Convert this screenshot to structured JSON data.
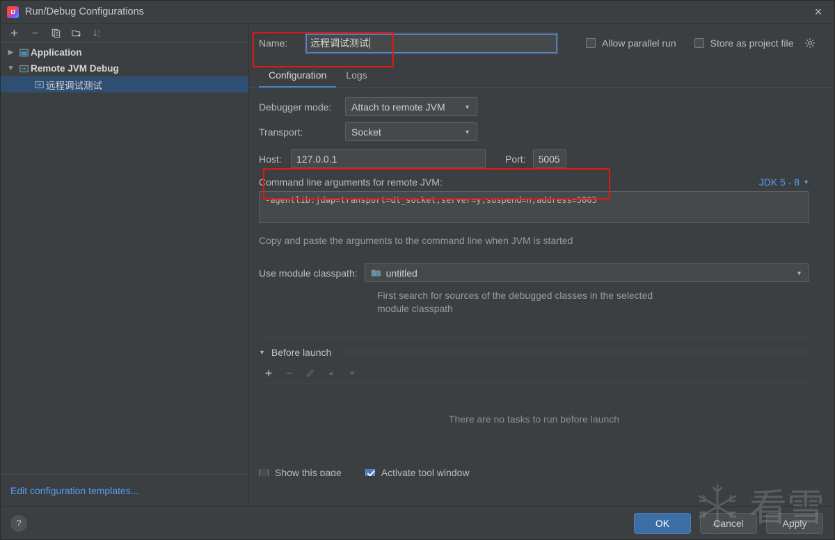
{
  "window": {
    "title": "Run/Debug Configurations",
    "app_icon": "intellij-idea-icon",
    "close_label": "×"
  },
  "sidebar": {
    "toolbar": [
      {
        "name": "add-configuration-button",
        "glyph": "+",
        "enabled": true
      },
      {
        "name": "remove-configuration-button",
        "glyph": "−",
        "enabled": false
      },
      {
        "name": "copy-configuration-button",
        "glyph": "copy-icon",
        "enabled": true
      },
      {
        "name": "new-folder-button",
        "glyph": "folder-add-icon",
        "enabled": true
      },
      {
        "name": "sort-configurations-button",
        "glyph": "sort-az-icon",
        "enabled": false
      }
    ],
    "tree": [
      {
        "label": "Application",
        "expanded": false,
        "selected": false,
        "icon": "application-icon",
        "level": 0
      },
      {
        "label": "Remote JVM Debug",
        "expanded": true,
        "selected": false,
        "icon": "remote-debug-icon",
        "level": 0
      },
      {
        "label": "远程调试测试",
        "expanded": null,
        "selected": true,
        "icon": "remote-debug-icon",
        "level": 1
      }
    ],
    "edit_templates_link": "Edit configuration templates..."
  },
  "header": {
    "name_label": "Name:",
    "name_value": "远程调试测试",
    "allow_parallel_run": {
      "label": "Allow parallel run",
      "checked": false
    },
    "store_as_project_file": {
      "label": "Store as project file",
      "checked": false
    },
    "gear_icon": "gear-icon"
  },
  "tabs": [
    {
      "label": "Configuration",
      "active": true
    },
    {
      "label": "Logs",
      "active": false
    }
  ],
  "configuration": {
    "debugger_mode": {
      "label": "Debugger mode:",
      "value": "Attach to remote JVM"
    },
    "transport": {
      "label": "Transport:",
      "value": "Socket"
    },
    "host": {
      "label": "Host:",
      "value": "127.0.0.1"
    },
    "port": {
      "label": "Port:",
      "value": "5005"
    },
    "args_title": "Command line arguments for remote JVM:",
    "jdk_select": "JDK 5 - 8",
    "args_value": "-agentlib:jdwp=transport=dt_socket,server=y,suspend=n,address=5005",
    "args_hint": "Copy and paste the arguments to the command line when JVM is started",
    "classpath": {
      "label": "Use module classpath:",
      "value": "untitled",
      "hint": "First search for sources of the debugged classes in the selected module classpath"
    }
  },
  "before_launch": {
    "title": "Before launch",
    "expanded": true,
    "toolbar": [
      {
        "name": "add-task-button",
        "glyph": "+",
        "enabled": true
      },
      {
        "name": "remove-task-button",
        "glyph": "−",
        "enabled": false
      },
      {
        "name": "edit-task-button",
        "glyph": "pencil-icon",
        "enabled": false
      },
      {
        "name": "move-task-up-button",
        "glyph": "arrow-up-icon",
        "enabled": false
      },
      {
        "name": "move-task-down-button",
        "glyph": "arrow-down-icon",
        "enabled": false
      }
    ],
    "empty_text": "There are no tasks to run before launch",
    "show_page": {
      "label": "Show this page",
      "checked": false
    },
    "activate_tool_window": {
      "label": "Activate tool window",
      "checked": true
    }
  },
  "footer": {
    "help_label": "?",
    "ok_label": "OK",
    "cancel_label": "Cancel",
    "apply_label": "Apply"
  },
  "watermark": {
    "text": "看雪",
    "logo": "snowflake-icon"
  },
  "colors": {
    "background": "#3c3f41",
    "field_background": "#45494a",
    "accent_blue": "#4a88c7",
    "link_blue": "#589df6",
    "selection_blue": "#2f4f72",
    "annotation_red": "#e81414",
    "primary_button": "#3c6ea5"
  }
}
